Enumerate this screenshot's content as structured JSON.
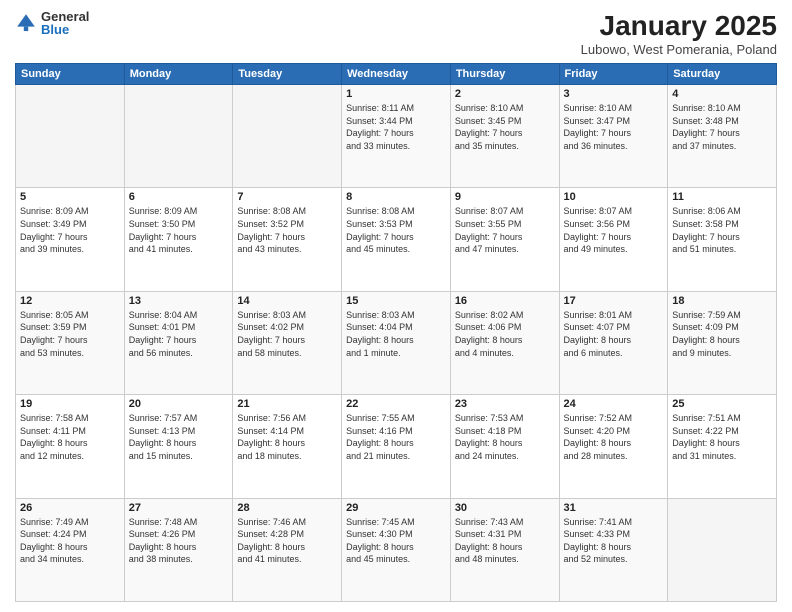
{
  "header": {
    "logo_general": "General",
    "logo_blue": "Blue",
    "month_title": "January 2025",
    "location": "Lubowo, West Pomerania, Poland"
  },
  "weekdays": [
    "Sunday",
    "Monday",
    "Tuesday",
    "Wednesday",
    "Thursday",
    "Friday",
    "Saturday"
  ],
  "weeks": [
    [
      {
        "day": "",
        "info": ""
      },
      {
        "day": "",
        "info": ""
      },
      {
        "day": "",
        "info": ""
      },
      {
        "day": "1",
        "info": "Sunrise: 8:11 AM\nSunset: 3:44 PM\nDaylight: 7 hours\nand 33 minutes."
      },
      {
        "day": "2",
        "info": "Sunrise: 8:10 AM\nSunset: 3:45 PM\nDaylight: 7 hours\nand 35 minutes."
      },
      {
        "day": "3",
        "info": "Sunrise: 8:10 AM\nSunset: 3:47 PM\nDaylight: 7 hours\nand 36 minutes."
      },
      {
        "day": "4",
        "info": "Sunrise: 8:10 AM\nSunset: 3:48 PM\nDaylight: 7 hours\nand 37 minutes."
      }
    ],
    [
      {
        "day": "5",
        "info": "Sunrise: 8:09 AM\nSunset: 3:49 PM\nDaylight: 7 hours\nand 39 minutes."
      },
      {
        "day": "6",
        "info": "Sunrise: 8:09 AM\nSunset: 3:50 PM\nDaylight: 7 hours\nand 41 minutes."
      },
      {
        "day": "7",
        "info": "Sunrise: 8:08 AM\nSunset: 3:52 PM\nDaylight: 7 hours\nand 43 minutes."
      },
      {
        "day": "8",
        "info": "Sunrise: 8:08 AM\nSunset: 3:53 PM\nDaylight: 7 hours\nand 45 minutes."
      },
      {
        "day": "9",
        "info": "Sunrise: 8:07 AM\nSunset: 3:55 PM\nDaylight: 7 hours\nand 47 minutes."
      },
      {
        "day": "10",
        "info": "Sunrise: 8:07 AM\nSunset: 3:56 PM\nDaylight: 7 hours\nand 49 minutes."
      },
      {
        "day": "11",
        "info": "Sunrise: 8:06 AM\nSunset: 3:58 PM\nDaylight: 7 hours\nand 51 minutes."
      }
    ],
    [
      {
        "day": "12",
        "info": "Sunrise: 8:05 AM\nSunset: 3:59 PM\nDaylight: 7 hours\nand 53 minutes."
      },
      {
        "day": "13",
        "info": "Sunrise: 8:04 AM\nSunset: 4:01 PM\nDaylight: 7 hours\nand 56 minutes."
      },
      {
        "day": "14",
        "info": "Sunrise: 8:03 AM\nSunset: 4:02 PM\nDaylight: 7 hours\nand 58 minutes."
      },
      {
        "day": "15",
        "info": "Sunrise: 8:03 AM\nSunset: 4:04 PM\nDaylight: 8 hours\nand 1 minute."
      },
      {
        "day": "16",
        "info": "Sunrise: 8:02 AM\nSunset: 4:06 PM\nDaylight: 8 hours\nand 4 minutes."
      },
      {
        "day": "17",
        "info": "Sunrise: 8:01 AM\nSunset: 4:07 PM\nDaylight: 8 hours\nand 6 minutes."
      },
      {
        "day": "18",
        "info": "Sunrise: 7:59 AM\nSunset: 4:09 PM\nDaylight: 8 hours\nand 9 minutes."
      }
    ],
    [
      {
        "day": "19",
        "info": "Sunrise: 7:58 AM\nSunset: 4:11 PM\nDaylight: 8 hours\nand 12 minutes."
      },
      {
        "day": "20",
        "info": "Sunrise: 7:57 AM\nSunset: 4:13 PM\nDaylight: 8 hours\nand 15 minutes."
      },
      {
        "day": "21",
        "info": "Sunrise: 7:56 AM\nSunset: 4:14 PM\nDaylight: 8 hours\nand 18 minutes."
      },
      {
        "day": "22",
        "info": "Sunrise: 7:55 AM\nSunset: 4:16 PM\nDaylight: 8 hours\nand 21 minutes."
      },
      {
        "day": "23",
        "info": "Sunrise: 7:53 AM\nSunset: 4:18 PM\nDaylight: 8 hours\nand 24 minutes."
      },
      {
        "day": "24",
        "info": "Sunrise: 7:52 AM\nSunset: 4:20 PM\nDaylight: 8 hours\nand 28 minutes."
      },
      {
        "day": "25",
        "info": "Sunrise: 7:51 AM\nSunset: 4:22 PM\nDaylight: 8 hours\nand 31 minutes."
      }
    ],
    [
      {
        "day": "26",
        "info": "Sunrise: 7:49 AM\nSunset: 4:24 PM\nDaylight: 8 hours\nand 34 minutes."
      },
      {
        "day": "27",
        "info": "Sunrise: 7:48 AM\nSunset: 4:26 PM\nDaylight: 8 hours\nand 38 minutes."
      },
      {
        "day": "28",
        "info": "Sunrise: 7:46 AM\nSunset: 4:28 PM\nDaylight: 8 hours\nand 41 minutes."
      },
      {
        "day": "29",
        "info": "Sunrise: 7:45 AM\nSunset: 4:30 PM\nDaylight: 8 hours\nand 45 minutes."
      },
      {
        "day": "30",
        "info": "Sunrise: 7:43 AM\nSunset: 4:31 PM\nDaylight: 8 hours\nand 48 minutes."
      },
      {
        "day": "31",
        "info": "Sunrise: 7:41 AM\nSunset: 4:33 PM\nDaylight: 8 hours\nand 52 minutes."
      },
      {
        "day": "",
        "info": ""
      }
    ]
  ]
}
